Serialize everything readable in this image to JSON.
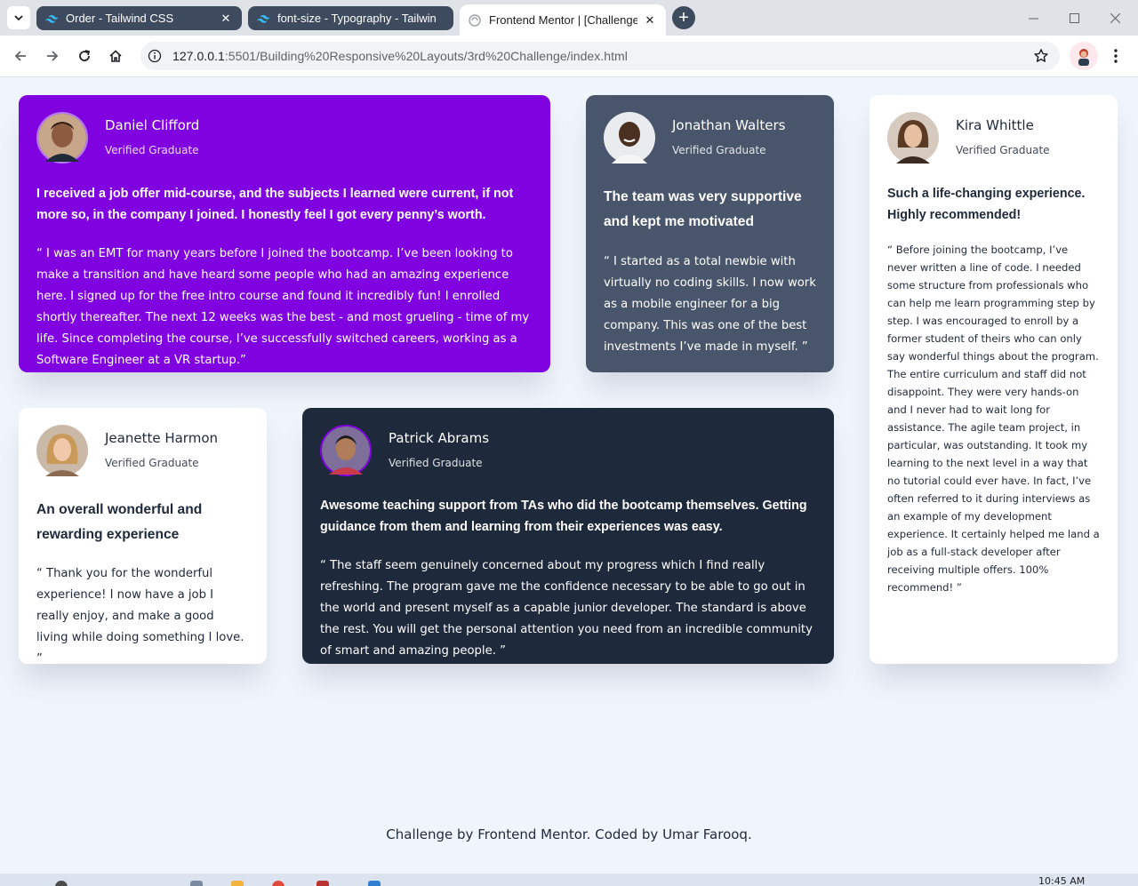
{
  "browser": {
    "tabs": [
      {
        "title": "Order - Tailwind CSS",
        "favicon": "tailwind-icon",
        "active": false
      },
      {
        "title": "font-size - Typography - Tailwin",
        "favicon": "tailwind-icon",
        "active": false
      },
      {
        "title": "Frontend Mentor | [Challenge N",
        "favicon": "frontend-mentor-icon",
        "active": true
      }
    ],
    "url_host": "127.0.0.1",
    "url_rest": ":5501/Building%20Responsive%20Layouts/3rd%20Challenge/index.html"
  },
  "testimonials": [
    {
      "name": "Daniel Clifford",
      "role": "Verified Graduate",
      "headline": "I received a job offer mid-course, and the subjects I learned were current, if not more so, in the company I joined. I honestly feel I got every penny’s worth.",
      "quote": "“ I was an EMT for many years before I joined the bootcamp. I’ve been looking to make a transition and have heard some people who had an amazing experience here. I signed up for the free intro course and found it incredibly fun! I enrolled shortly thereafter. The next 12 weeks was the best - and most grueling - time of my life. Since completing the course, I’ve successfully switched careers, working as a Software Engineer at a VR startup.”",
      "color": "#8002e0"
    },
    {
      "name": "Jonathan Walters",
      "role": "Verified Graduate",
      "headline": "The team was very supportive and kept me motivated",
      "quote": "“ I started as a total newbie with virtually no coding skills. I now work as a mobile engineer for a big company. This was one of the best investments I’ve made in myself. ”",
      "color": "#48556a"
    },
    {
      "name": "Kira Whittle",
      "role": "Verified Graduate",
      "headline": "Such a life-changing experience. Highly recommended!",
      "quote": "“ Before joining the bootcamp, I’ve never written a line of code. I needed some structure from professionals who can help me learn programming step by step. I was encouraged to enroll by a former student of theirs who can only say wonderful things about the program. The entire curriculum and staff did not disappoint. They were very hands-on and I never had to wait long for assistance. The agile team project, in particular, was outstanding. It took my learning to the next level in a way that no tutorial could ever have. In fact, I’ve often referred to it during interviews as an example of my development experience. It certainly helped me land a job as a full-stack developer after receiving multiple offers. 100% recommend! ”",
      "color": "#ffffff"
    },
    {
      "name": "Jeanette Harmon",
      "role": "Verified Graduate",
      "headline": "An overall wonderful and rewarding experience",
      "quote": "“ Thank you for the wonderful experience! I now have a job I really enjoy, and make a good living while doing something I love. ”",
      "color": "#ffffff"
    },
    {
      "name": "Patrick Abrams",
      "role": "Verified Graduate",
      "headline": "Awesome teaching support from TAs who did the bootcamp themselves. Getting guidance from them and learning from their experiences was easy.",
      "quote": "“ The staff seem genuinely concerned about my progress which I find really refreshing. The program gave me the confidence necessary to be able to go out in the world and present myself as a capable junior developer. The standard is above the rest. You will get the personal attention you need from an incredible community of smart and amazing people. ”",
      "color": "#1e293b"
    }
  ],
  "footer": "Challenge by Frontend Mentor. Coded by Umar Farooq.",
  "taskbar": {
    "clock": "10:45 AM"
  }
}
